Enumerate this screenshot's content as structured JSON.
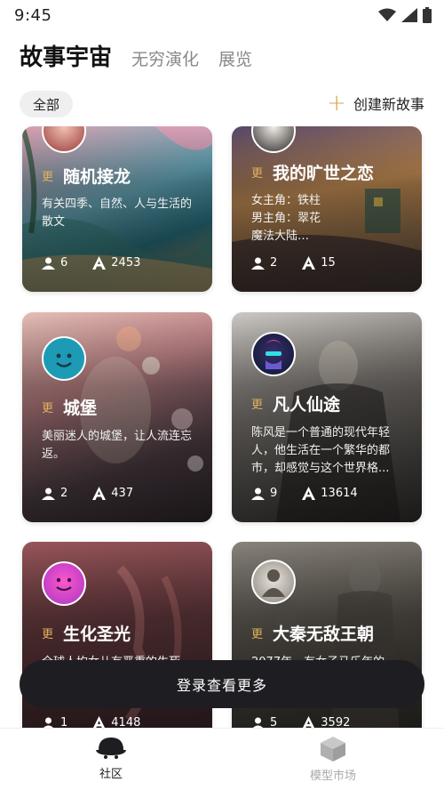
{
  "status_bar": {
    "time": "9:45",
    "icons": [
      "wifi-icon",
      "signal-icon",
      "battery-icon"
    ]
  },
  "header": {
    "tabs": [
      {
        "label": "故事宇宙",
        "active": true
      },
      {
        "label": "无穷演化",
        "active": false
      },
      {
        "label": "展览",
        "active": false
      }
    ]
  },
  "filter": {
    "chip": "全部",
    "create_label": "创建新故事",
    "create_icon": "plus-icon"
  },
  "cards": [
    {
      "badge": "更",
      "title": "随机接龙",
      "desc": "有关四季、自然、人与生活的散文",
      "members": "6",
      "words": "2453"
    },
    {
      "badge": "更",
      "title": "我的旷世之恋",
      "desc": "女主角：铁柱\n男主角：翠花\n魔法大陆…",
      "members": "2",
      "words": "15"
    },
    {
      "badge": "更",
      "title": "城堡",
      "desc": "美丽迷人的城堡，让人流连忘返。",
      "members": "2",
      "words": "437"
    },
    {
      "badge": "更",
      "title": "凡人仙途",
      "desc": "陈风是一个普通的现代年轻人，他生活在一个繁华的都市，却感觉与这个世界格...",
      "members": "9",
      "words": "13614"
    },
    {
      "badge": "更",
      "title": "生化圣光",
      "desc": "全球人均女儿有严重的生死...",
      "members": "1",
      "words": "4148"
    },
    {
      "badge": "更",
      "title": "大秦无敌王朝",
      "desc": "2077年，有女子马乐年的...",
      "members": "5",
      "words": "3592"
    }
  ],
  "login_bar": {
    "label": "登录查看更多"
  },
  "bottom_nav": [
    {
      "label": "社区",
      "icon": "community-icon",
      "active": true
    },
    {
      "label": "模型市场",
      "icon": "cube-icon",
      "active": false
    }
  ],
  "colors": {
    "accent": "#d6a54e",
    "dark": "#1e1d22"
  }
}
